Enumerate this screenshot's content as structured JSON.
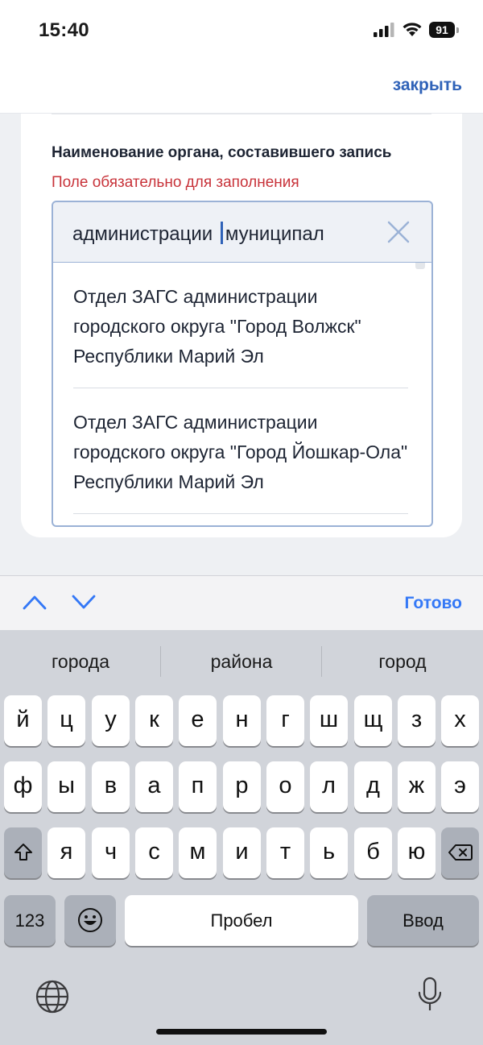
{
  "status_bar": {
    "time": "15:40",
    "battery_level": "91"
  },
  "top_nav": {
    "close_label": "закрыть"
  },
  "form": {
    "field_label": "Наименование органа, составившего запись",
    "field_error": "Поле обязательно для заполнения",
    "input": {
      "text_before_caret": "администрации ",
      "text_after_caret": "муниципал"
    },
    "dropdown": {
      "options": [
        {
          "label": "Отдел ЗАГС администрации городского округа \"Город Волжск\" Республики Марий Эл"
        },
        {
          "label": "Отдел ЗАГС администрации городского округа \"Город Йошкар-Ола\" Республики Марий Эл"
        }
      ]
    }
  },
  "accessory_bar": {
    "done_label": "Готово"
  },
  "keyboard": {
    "suggestions": [
      "города",
      "района",
      "город"
    ],
    "row1": [
      "й",
      "ц",
      "у",
      "к",
      "е",
      "н",
      "г",
      "ш",
      "щ",
      "з",
      "х"
    ],
    "row2": [
      "ф",
      "ы",
      "в",
      "а",
      "п",
      "р",
      "о",
      "л",
      "д",
      "ж",
      "э"
    ],
    "row3": [
      "я",
      "ч",
      "с",
      "м",
      "и",
      "т",
      "ь",
      "б",
      "ю"
    ],
    "numbers_label": "123",
    "space_label": "Пробел",
    "return_label": "Ввод"
  },
  "colors": {
    "accent": "#2f62b8",
    "error": "#c8333a",
    "ios_blue": "#3478f6",
    "keyboard_bg": "#d1d4da"
  }
}
